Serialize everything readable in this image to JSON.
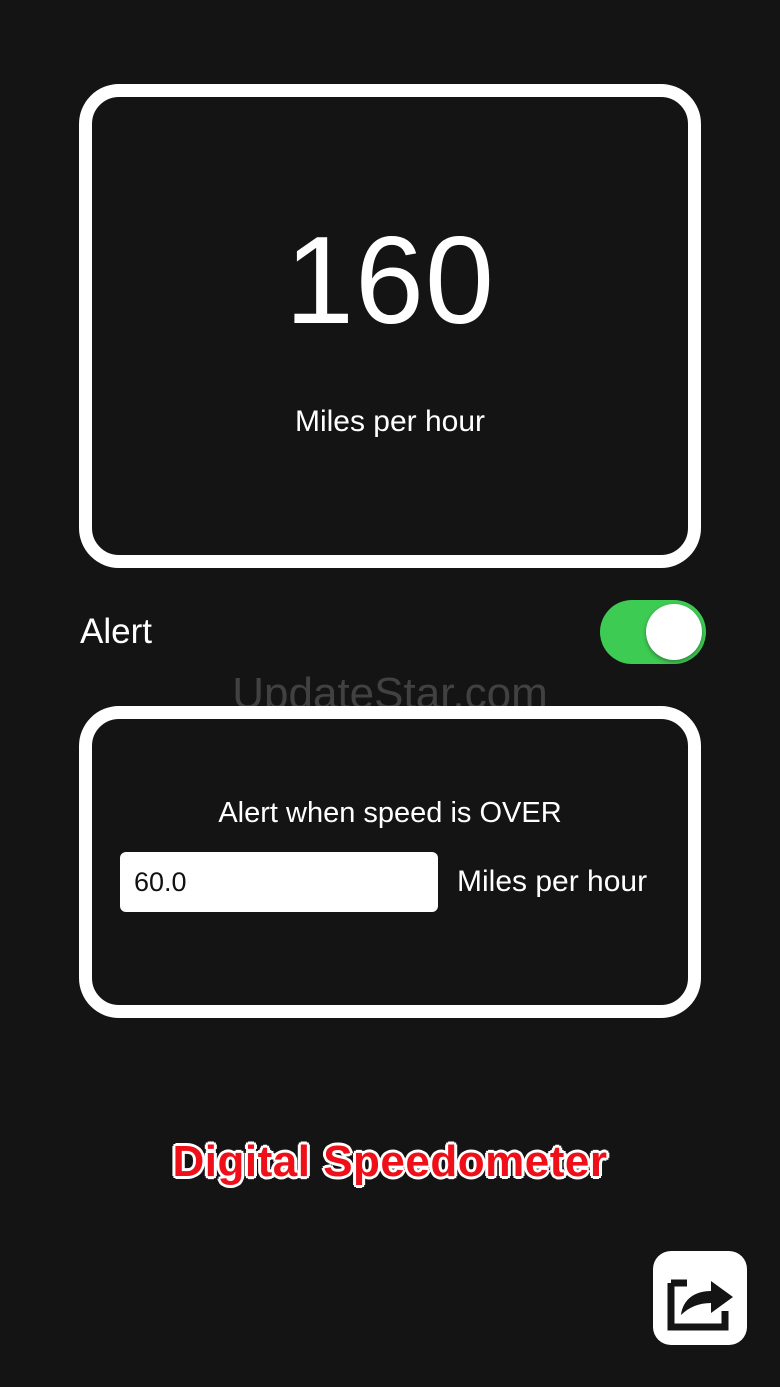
{
  "speedometer": {
    "speed": "160",
    "unit": "Miles per hour"
  },
  "alert": {
    "label": "Alert",
    "enabled": true,
    "toggle_color": "#3ecb53"
  },
  "watermark": "UpdateStar.com",
  "threshold": {
    "heading": "Alert when speed is OVER",
    "value": "60.0",
    "unit": "Miles per hour"
  },
  "app_title": "Digital Speedometer",
  "app_title_color": "#ef0f18",
  "icons": {
    "share": "share-icon"
  }
}
